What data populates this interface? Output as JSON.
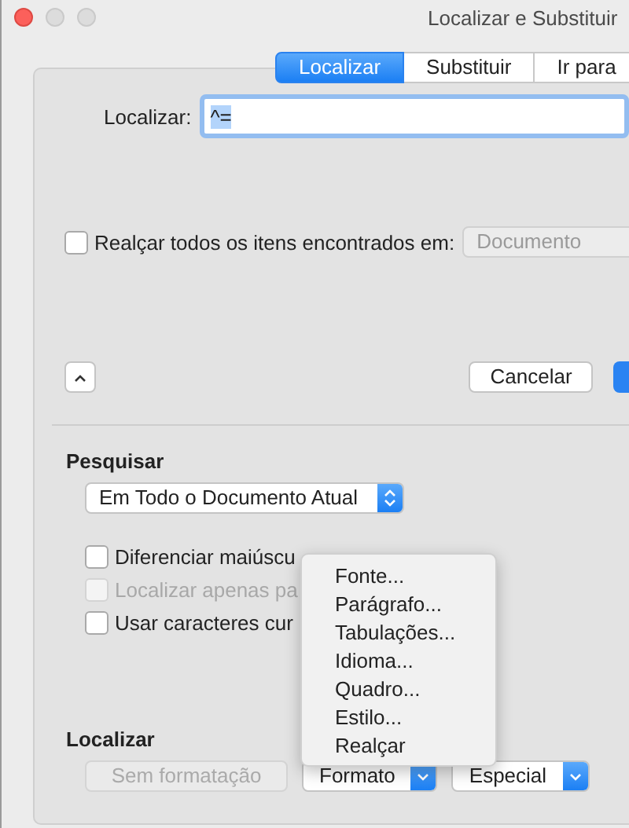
{
  "window": {
    "title": "Localizar e Substituir"
  },
  "tabs": [
    {
      "label": "Localizar",
      "selected": true
    },
    {
      "label": "Substituir",
      "selected": false
    },
    {
      "label": "Ir para",
      "selected": false
    }
  ],
  "find_field": {
    "label": "Localizar:",
    "value": "^="
  },
  "highlight_all": {
    "label": "Realçar todos os itens encontrados em:",
    "checked": false,
    "scope": "Documento"
  },
  "buttons": [
    {
      "label": "Cancelar"
    }
  ],
  "search": {
    "heading": "Pesquisar",
    "scope": "Em Todo o Documento Atual",
    "options": [
      {
        "label": "Diferenciar maiúscu",
        "checked": false,
        "disabled": false
      },
      {
        "label": "Localizar apenas pa",
        "checked": false,
        "disabled": true
      },
      {
        "label": "Usar caracteres cur",
        "checked": false,
        "disabled": false
      }
    ]
  },
  "find_format": {
    "heading": "Localizar",
    "buttons": [
      {
        "label": "Sem formatação",
        "kind": "plain",
        "disabled": true
      },
      {
        "label": "Formato",
        "kind": "menu",
        "disabled": false
      },
      {
        "label": "Especial",
        "kind": "menu",
        "disabled": false
      }
    ]
  },
  "format_menu": {
    "items": [
      "Fonte...",
      "Parágrafo...",
      "Tabulações...",
      "Idioma...",
      "Quadro...",
      "Estilo...",
      "Realçar"
    ]
  }
}
